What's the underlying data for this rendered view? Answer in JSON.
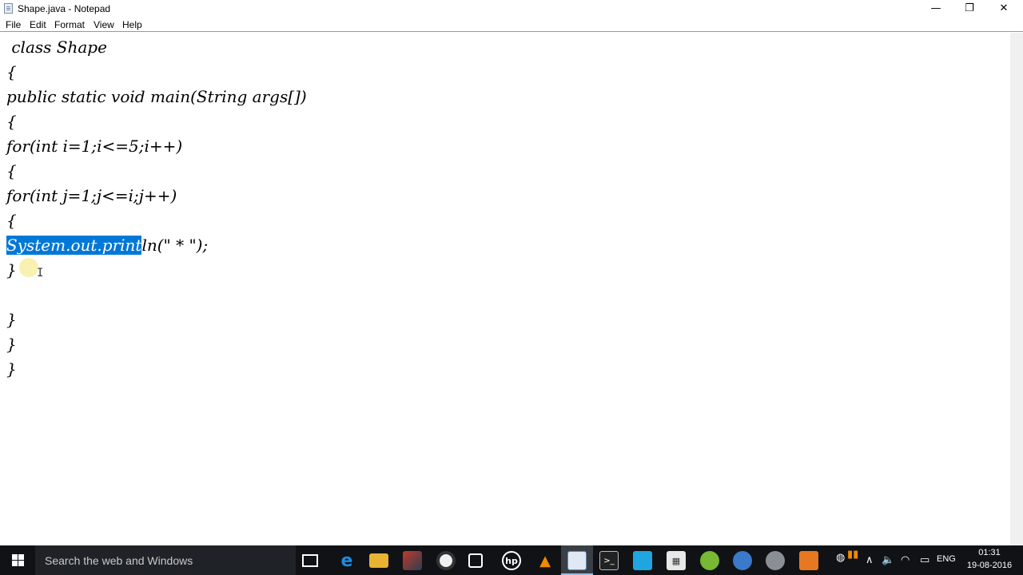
{
  "window": {
    "title": "Shape.java - Notepad",
    "minimize_glyph": "—",
    "maximize_glyph": "❐",
    "close_glyph": "✕"
  },
  "menu": {
    "file": "File",
    "edit": "Edit",
    "format": "Format",
    "view": "View",
    "help": "Help"
  },
  "editor": {
    "lines": [
      " class Shape",
      "{",
      "public static void main(String args[])",
      "{",
      "for(int i=1;i<=5;i++)",
      "{",
      "for(int j=1;j<=i;j++)",
      "{",
      "",
      "}",
      "",
      "}",
      "}",
      "}"
    ],
    "selected_text": "System.out.print",
    "unselected_rest": "ln(\" * \");",
    "selection_color": "#0078d7"
  },
  "taskbar": {
    "search_placeholder": "Search the web and Windows",
    "language": "ENG",
    "time": "01:31",
    "date": "19-08-2016",
    "icons": [
      "task-view-icon",
      "edge-icon",
      "file-explorer-icon",
      "app-icon",
      "chrome-icon",
      "store-icon",
      "hp-icon",
      "vlc-icon",
      "notepad-icon",
      "cmd-icon",
      "app-icon",
      "calculator-icon",
      "utorrent-icon",
      "firefox-icon",
      "app-icon",
      "app-icon"
    ]
  }
}
